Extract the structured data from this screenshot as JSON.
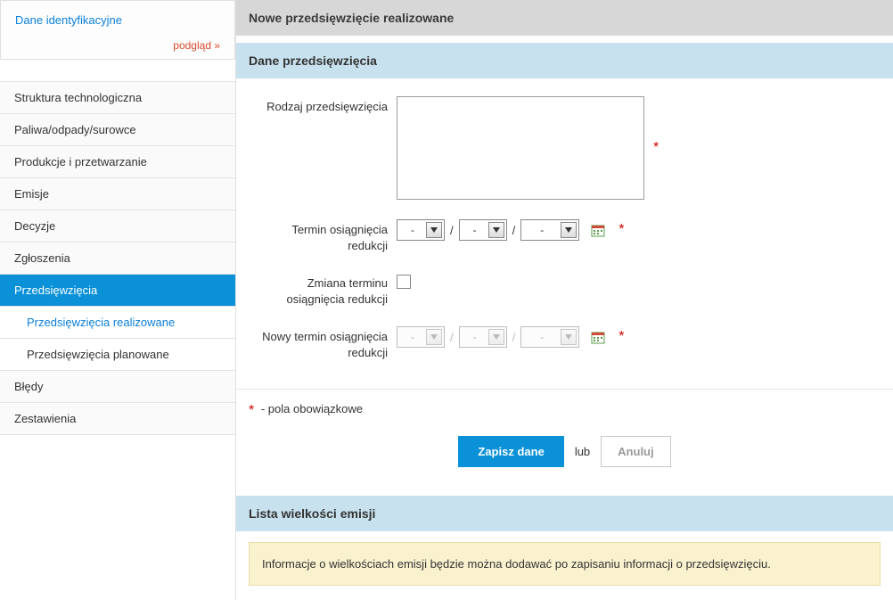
{
  "sidebar": {
    "top_title": "Dane identyfikacyjne",
    "top_link": "podgląd »",
    "items": [
      {
        "label": "Struktura technologiczna"
      },
      {
        "label": "Paliwa/odpady/surowce"
      },
      {
        "label": "Produkcje i przetwarzanie"
      },
      {
        "label": "Emisje"
      },
      {
        "label": "Decyzje"
      },
      {
        "label": "Zgłoszenia"
      },
      {
        "label": "Przedsięwzięcia"
      },
      {
        "label": "Przedsięwzięcia realizowane"
      },
      {
        "label": "Przedsięwzięcia planowane"
      },
      {
        "label": "Błędy"
      },
      {
        "label": "Zestawienia"
      }
    ]
  },
  "header": {
    "title": "Nowe przedsięwzięcie realizowane"
  },
  "section": {
    "title": "Dane przedsięwzięcia"
  },
  "form": {
    "rodzaj_label": "Rodzaj przedsięwzięcia",
    "rodzaj_value": "",
    "termin_label": "Termin osiągnięcia redukcji",
    "zmiana_label": "Zmiana terminu osiągnięcia redukcji",
    "nowy_termin_label": "Nowy termin osiągnięcia redukcji",
    "select_placeholder_dash": "-",
    "date_sep": "/",
    "required_hint": "- pola obowiązkowe",
    "required_mark": "*"
  },
  "actions": {
    "save": "Zapisz dane",
    "or": "lub",
    "cancel": "Anuluj"
  },
  "section2": {
    "title": "Lista wielkości emisji"
  },
  "info": {
    "text": "Informacje o wielkościach emisji będzie można dodawać po zapisaniu informacji o przedsięwzięciu."
  }
}
